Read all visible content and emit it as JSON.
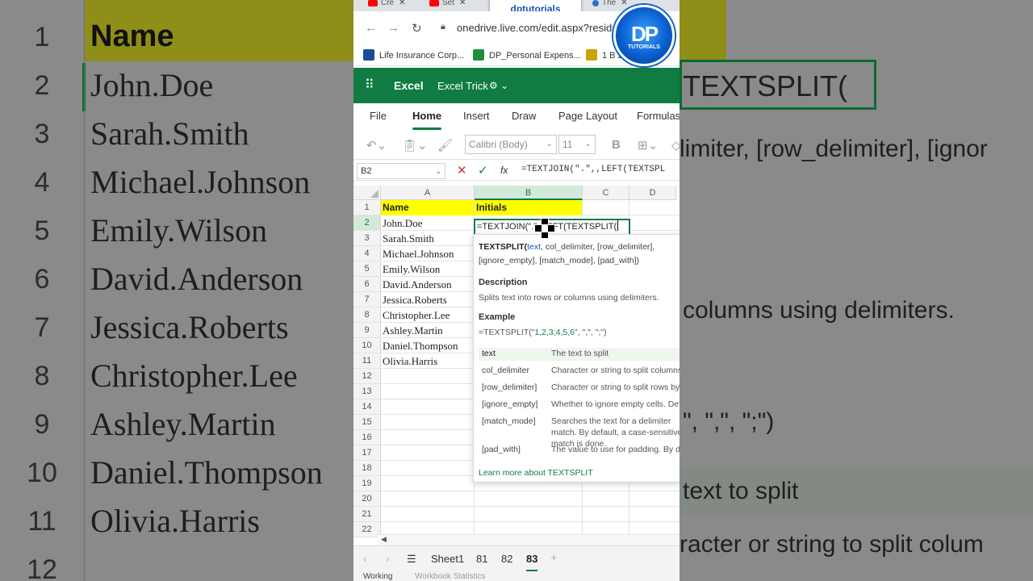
{
  "browser": {
    "tabs": [
      {
        "label": "Cre"
      },
      {
        "label": "Set"
      },
      {
        "label": "The"
      }
    ],
    "tab_close": "✕",
    "channel_badge": "dptutorials",
    "url": "onedrive.live.com/edit.aspx?resid=C",
    "bookmarks": [
      {
        "label": "Life Insurance Corp...",
        "color": "#1a4a9b"
      },
      {
        "label": "DP_Personal Expens...",
        "color": "#1e8e3e"
      },
      {
        "label": "1 B 2",
        "color": "#c9a300"
      }
    ],
    "logo_text": "DP",
    "logo_sub": "TUTORIALS"
  },
  "excel": {
    "app_name": "Excel",
    "doc_name": "Excel Trick",
    "menu": [
      "File",
      "Home",
      "Insert",
      "Draw",
      "Page Layout",
      "Formulas"
    ],
    "active_menu": "Home",
    "font_name": "Calibri (Body)",
    "font_size": "11",
    "bold_label": "B",
    "name_box": "B2",
    "fx_label": "fx",
    "formula": "=TEXTJOIN(\".\",,LEFT(TEXTSPL",
    "columns": [
      "A",
      "B",
      "C",
      "D"
    ],
    "row_numbers": [
      "1",
      "2",
      "3",
      "4",
      "5",
      "6",
      "7",
      "8",
      "9",
      "10",
      "11",
      "12",
      "13",
      "14",
      "15",
      "16",
      "17",
      "18",
      "19",
      "20",
      "21",
      "22"
    ],
    "header_a": "Name",
    "header_b": "Initials",
    "names": [
      "John.Doe",
      "Sarah.Smith",
      "Michael.Johnson",
      "Emily.Wilson",
      "David.Anderson",
      "Jessica.Roberts",
      "Christopher.Lee",
      "Ashley.Martin",
      "Daniel.Thompson",
      "Olivia.Harris"
    ],
    "active_cell_text": "=TEXTJOIN(\".\",,LEFT(TEXTSPLIT(",
    "highlight_color": "#ffff00",
    "accent": "#107c41"
  },
  "tooltip": {
    "func": "TEXTSPLIT(",
    "arg_current": "text",
    "sig_rest": ", col_delimiter, [row_delimiter], [ignore_empty], [match_mode], [pad_with])",
    "desc_title": "Description",
    "desc": "Splits text into rows or columns using delimiters.",
    "example_title": "Example",
    "example_prefix": "=TEXTSPLIT(\"",
    "example_nums": "1,2,3;4,5,6",
    "example_suffix": "\", \",\", \";\")",
    "args": [
      {
        "name": "text",
        "desc": "The text to split"
      },
      {
        "name": "col_delimiter",
        "desc": "Character or string to split columns by."
      },
      {
        "name": "[row_delimiter]",
        "desc": "Character or string to split rows by."
      },
      {
        "name": "[ignore_empty]",
        "desc": "Whether to ignore empty cells. Defaults to FALSE."
      },
      {
        "name": "[match_mode]",
        "desc": "Searches the text for a delimiter match. By default, a case-sensitive match is done."
      },
      {
        "name": "[pad_with]",
        "desc": "The value to use for padding. By default, #N/A is used."
      }
    ],
    "learn_more": "Learn more about TEXTSPLIT"
  },
  "sheets": {
    "tabs": [
      "Sheet1",
      "81",
      "82",
      "83"
    ],
    "active": "83",
    "add": "+"
  },
  "status": {
    "left": "Working",
    "right": "Workbook Statistics"
  },
  "background": {
    "row_numbers": [
      "1",
      "2",
      "3",
      "4",
      "5",
      "6",
      "7",
      "8",
      "9",
      "10",
      "11",
      "12"
    ],
    "header": "Name",
    "names": [
      "John.Doe",
      "Sarah.Smith",
      "Michael.Johnson",
      "Emily.Wilson",
      "David.Anderson",
      "Jessica.Roberts",
      "Christopher.Lee",
      "Ashley.Martin",
      "Daniel.Thompson",
      "Olivia.Harris"
    ],
    "right_texts": [
      "TEXTSPLIT(",
      "limiter, [row_delimiter], [ignor",
      "columns using delimiters.",
      "\", \",\", \";\")",
      "text to split",
      "racter or string to split colum"
    ]
  }
}
